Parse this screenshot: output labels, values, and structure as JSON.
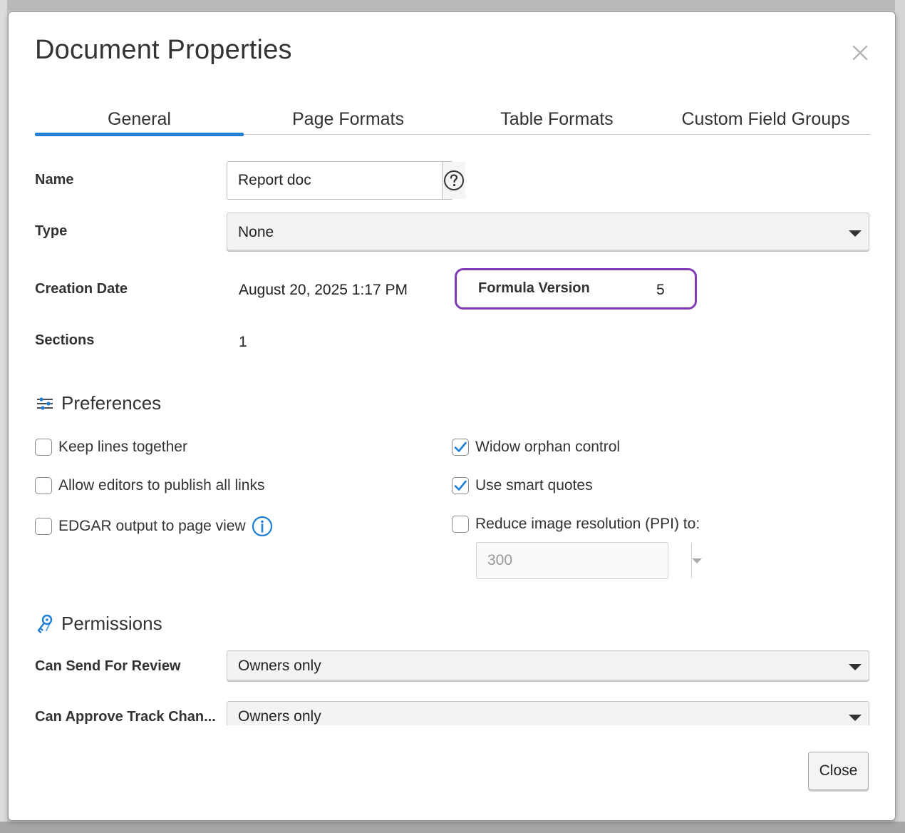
{
  "dialog": {
    "title": "Document Properties"
  },
  "tabs": [
    {
      "label": "General",
      "active": true
    },
    {
      "label": "Page Formats",
      "active": false
    },
    {
      "label": "Table Formats",
      "active": false
    },
    {
      "label": "Custom Field Groups",
      "active": false
    }
  ],
  "general": {
    "name_label": "Name",
    "name_value": "Report doc",
    "type_label": "Type",
    "type_value": "None",
    "creation_date_label": "Creation Date",
    "creation_date_value": "August 20, 2025 1:17 PM",
    "formula_version_label": "Formula Version",
    "formula_version_value": "5",
    "sections_label": "Sections",
    "sections_value": "1"
  },
  "preferences": {
    "title": "Preferences",
    "left": [
      {
        "label": "Keep lines together",
        "checked": false
      },
      {
        "label": "Allow editors to publish all links",
        "checked": false
      },
      {
        "label": "EDGAR output to page view",
        "checked": false
      }
    ],
    "right": [
      {
        "label": "Widow orphan control",
        "checked": true
      },
      {
        "label": "Use smart quotes",
        "checked": true
      },
      {
        "label": "Reduce image resolution (PPI) to:",
        "checked": false
      }
    ],
    "ppi_value": "300"
  },
  "permissions": {
    "title": "Permissions",
    "can_send_label": "Can Send For Review",
    "can_send_value": "Owners only",
    "can_approve_label": "Can Approve Track Chan...",
    "can_approve_value": "Owners only"
  },
  "footer": {
    "close_label": "Close"
  },
  "colors": {
    "accent": "#1f7fd6",
    "highlight": "#7e3bb5"
  }
}
